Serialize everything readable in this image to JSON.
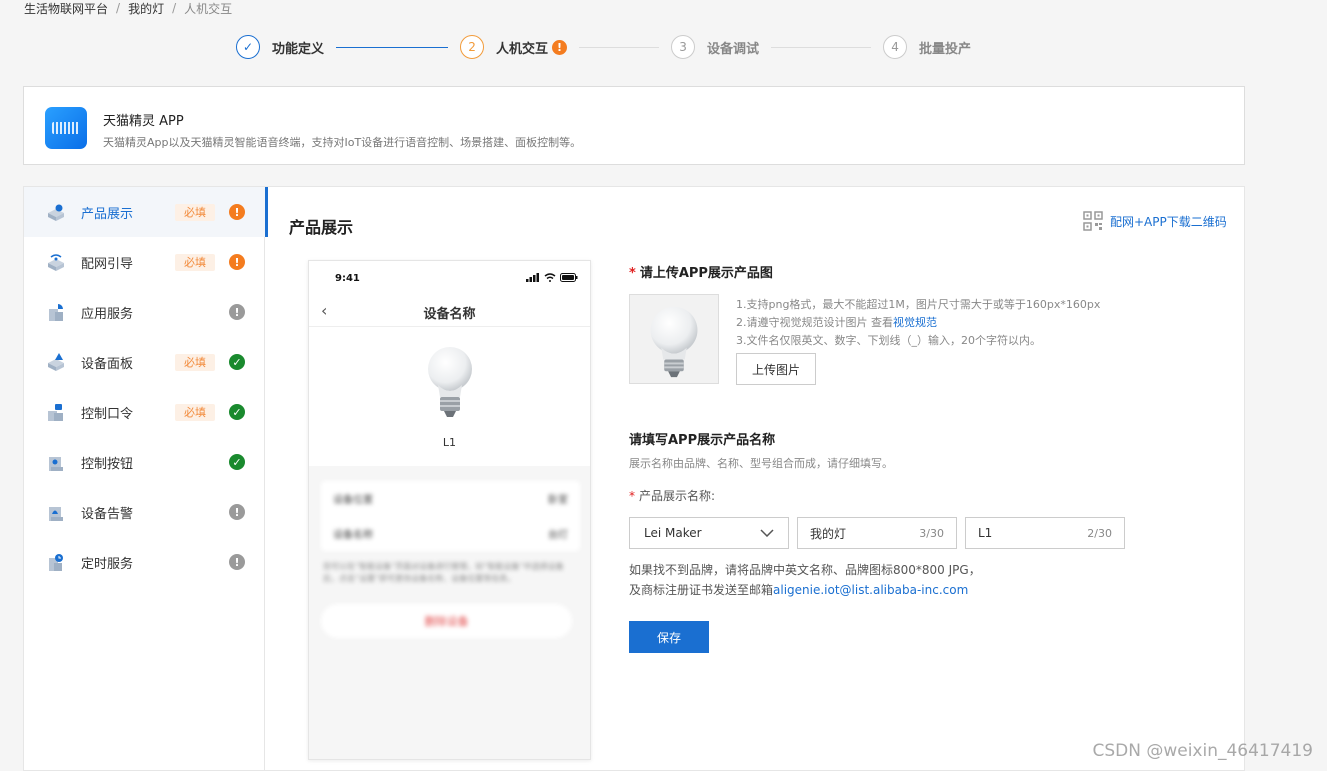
{
  "breadcrumb": [
    "生活物联网平台",
    "我的灯",
    "人机交互"
  ],
  "steps": [
    {
      "num": "✓",
      "label": "功能定义",
      "state": "done"
    },
    {
      "num": "2",
      "label": "人机交互",
      "state": "active"
    },
    {
      "num": "3",
      "label": "设备调试",
      "state": "todo"
    },
    {
      "num": "4",
      "label": "批量投产",
      "state": "todo"
    }
  ],
  "app": {
    "title": "天猫精灵 APP",
    "desc": "天猫精灵App以及天猫精灵智能语音终端，支持对IoT设备进行语音控制、场景搭建、面板控制等。"
  },
  "sidebar": {
    "items": [
      {
        "label": "产品展示",
        "required": "必填",
        "status": "warn"
      },
      {
        "label": "配网引导",
        "required": "必填",
        "status": "warn"
      },
      {
        "label": "应用服务",
        "required": "",
        "status": "info"
      },
      {
        "label": "设备面板",
        "required": "必填",
        "status": "ok"
      },
      {
        "label": "控制口令",
        "required": "必填",
        "status": "ok"
      },
      {
        "label": "控制按钮",
        "required": "",
        "status": "ok"
      },
      {
        "label": "设备告警",
        "required": "",
        "status": "info"
      },
      {
        "label": "定时服务",
        "required": "",
        "status": "info"
      }
    ]
  },
  "content": {
    "title": "产品展示",
    "qr_link": "配网+APP下载二维码"
  },
  "phone": {
    "time": "9:41",
    "title": "设备名称",
    "device_name": "L1",
    "row1_label": "设备位置",
    "row1_value": "卧室",
    "row2_label": "设备名称",
    "row2_value": "台灯",
    "note": "您可以在“智能设备”页面对设备进行管理，如“智能设备”中选择设备后，点击“设置”即可更改设备名称、设备位置等信息。",
    "delete": "删除设备"
  },
  "form": {
    "upload_title": "请上传APP展示产品图",
    "hint1": "1.支持png格式，最大不能超过1M，图片尺寸需大于或等于160px*160px",
    "hint2_prefix": "2.请遵守视觉规范设计图片 查看",
    "hint2_link": "视觉规范",
    "hint3": "3.文件名仅限英文、数字、下划线（_）输入，20个字符以内。",
    "upload_btn": "上传图片",
    "name_title": "请填写APP展示产品名称",
    "name_hint": "展示名称由品牌、名称、型号组合而成，请仔细填写。",
    "field_label": "产品展示名称:",
    "brand": "Lei Maker",
    "name_value": "我的灯",
    "name_count": "3/30",
    "model_value": "L1",
    "model_count": "2/30",
    "brand_hint1": "如果找不到品牌，请将品牌中英文名称、品牌图标800*800 JPG，",
    "brand_hint2_prefix": "及商标注册证书发送至邮箱",
    "brand_hint2_mail": "aligenie.iot@list.alibaba-inc.com",
    "save": "保存"
  },
  "watermark": "CSDN @weixin_46417419"
}
